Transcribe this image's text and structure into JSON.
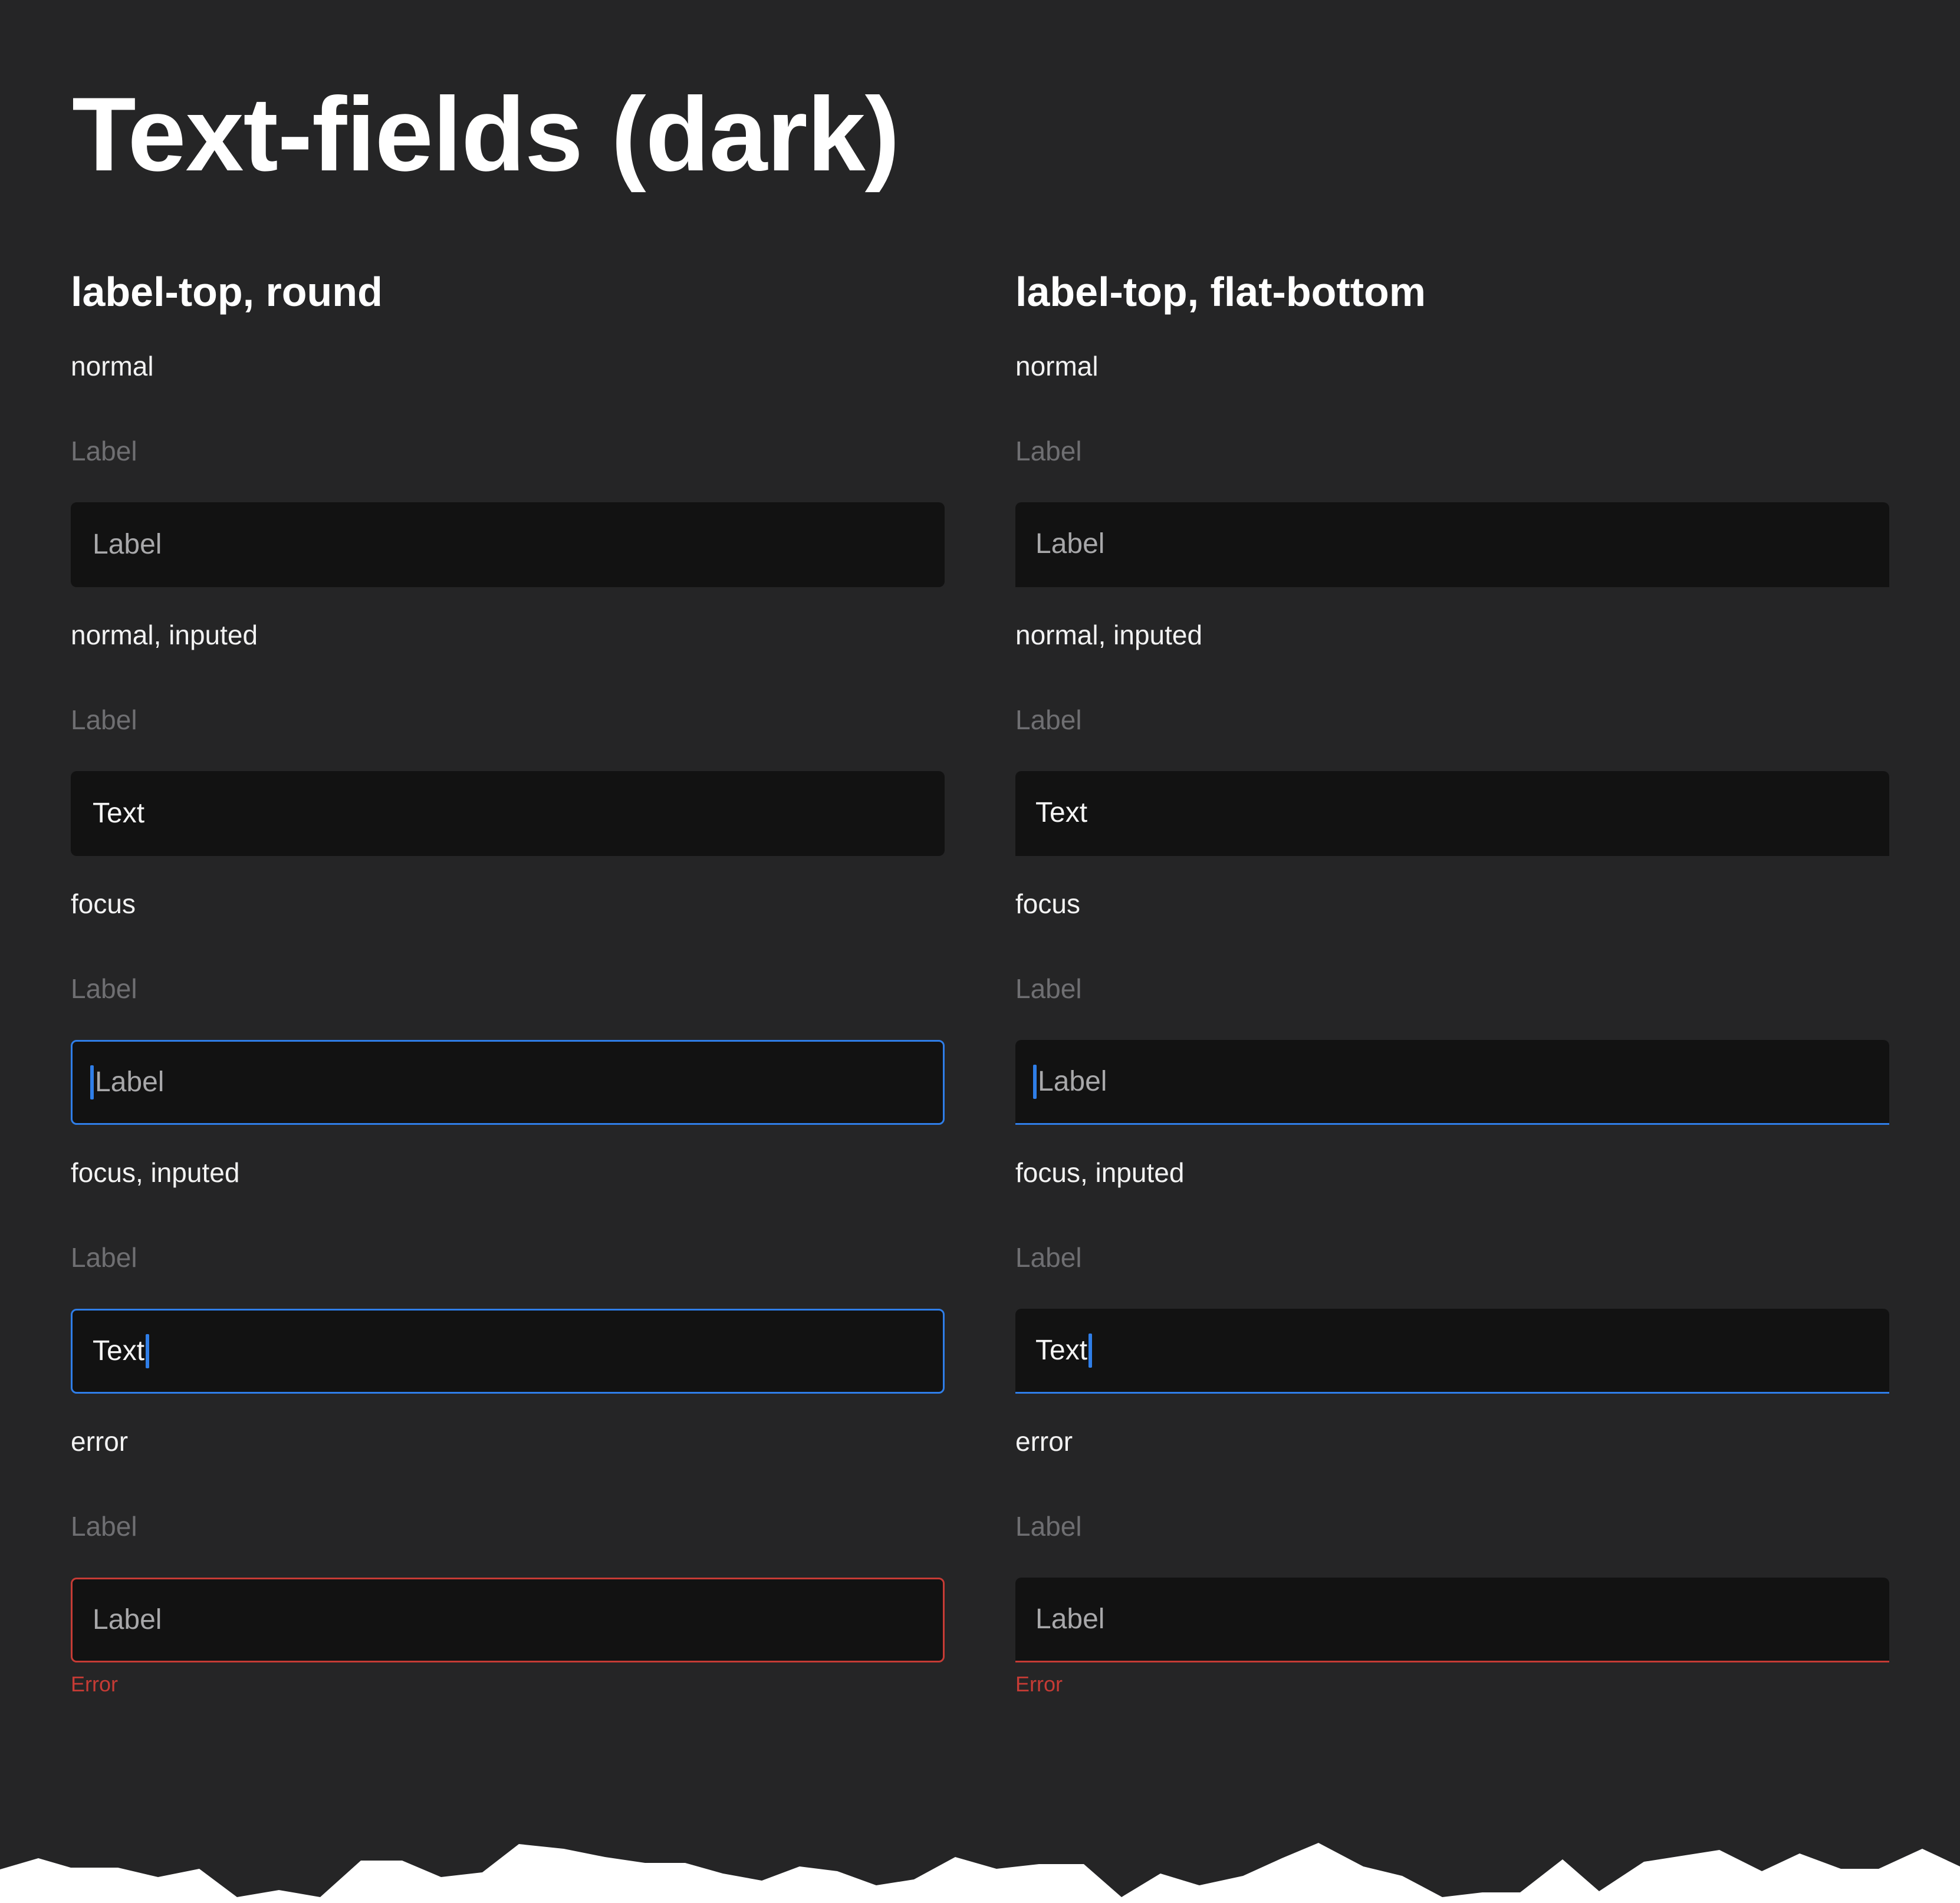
{
  "page_title": "Text-fields (dark)",
  "columns": {
    "left": {
      "heading": "label-top, round",
      "states": [
        {
          "caption": "normal",
          "label": "Label",
          "field_text": "Label"
        },
        {
          "caption": "normal, inputed",
          "label": "Label",
          "field_text": "Text"
        },
        {
          "caption": "focus",
          "label": "Label",
          "field_text": "Label"
        },
        {
          "caption": "focus, inputed",
          "label": "Label",
          "field_text": "Text"
        },
        {
          "caption": "error",
          "label": "Label",
          "field_text": "Label",
          "error_text": "Error"
        }
      ]
    },
    "right": {
      "heading": "label-top, flat-bottom",
      "states": [
        {
          "caption": "normal",
          "label": "Label",
          "field_text": "Label"
        },
        {
          "caption": "normal, inputed",
          "label": "Label",
          "field_text": "Text"
        },
        {
          "caption": "focus",
          "label": "Label",
          "field_text": "Label"
        },
        {
          "caption": "focus, inputed",
          "label": "Label",
          "field_text": "Text"
        },
        {
          "caption": "error",
          "label": "Label",
          "field_text": "Label",
          "error_text": "Error"
        }
      ]
    }
  },
  "colors": {
    "background": "#252526",
    "field_background": "#121212",
    "focus": "#2f7ee8",
    "error": "#c63b35",
    "label": "#6f6f72"
  }
}
